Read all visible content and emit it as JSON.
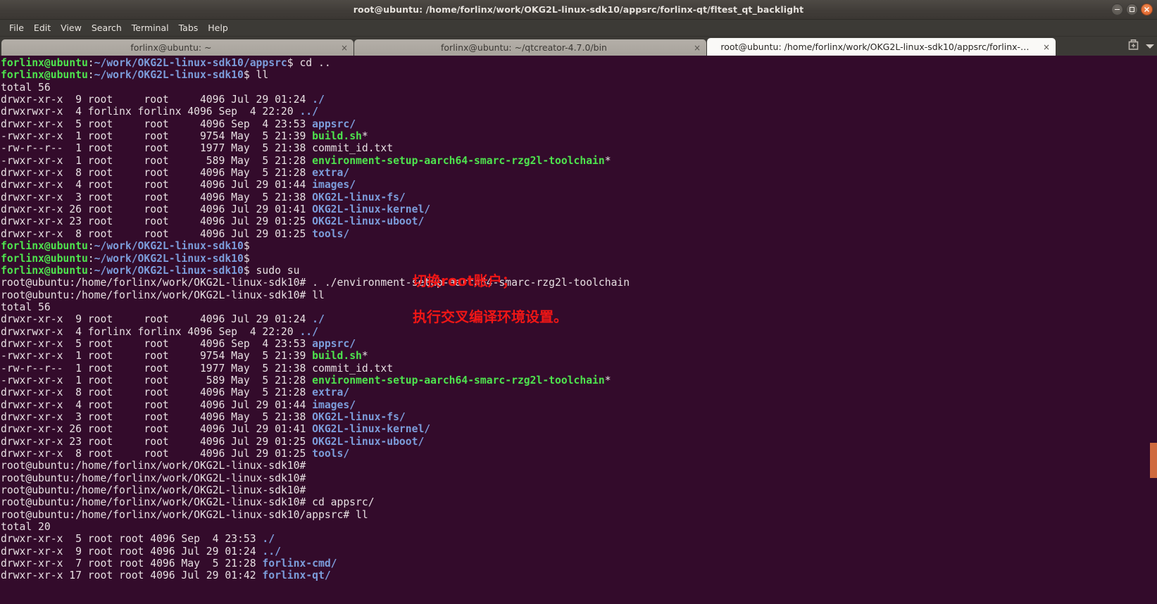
{
  "window": {
    "title": "root@ubuntu: /home/forlinx/work/OKG2L-linux-sdk10/appsrc/forlinx-qt/fltest_qt_backlight",
    "controls": {
      "minimize": "minimize",
      "maximize": "maximize",
      "close": "close"
    }
  },
  "menubar": {
    "items": [
      {
        "label": "File"
      },
      {
        "label": "Edit"
      },
      {
        "label": "View"
      },
      {
        "label": "Search"
      },
      {
        "label": "Terminal"
      },
      {
        "label": "Tabs"
      },
      {
        "label": "Help"
      }
    ]
  },
  "tabs": [
    {
      "label": "forlinx@ubuntu: ~",
      "close": "×",
      "active": false
    },
    {
      "label": "forlinx@ubuntu: ~/qtcreator-4.7.0/bin",
      "close": "×",
      "active": false
    },
    {
      "label": "root@ubuntu: /home/forlinx/work/OKG2L-linux-sdk10/appsrc/forlinx-…",
      "close": "×",
      "active": true
    }
  ],
  "tabbar_right": {
    "new_tab": "new-tab",
    "tab_list": "tab-list-dropdown"
  },
  "terminal": {
    "colors": {
      "background": "#330b2b",
      "foreground": "#e8e0e3",
      "green": "#4ee44e",
      "blue": "#7c9ddb",
      "annotation_red": "#f01616",
      "scrollbar": "#cf6a3f"
    },
    "lines": [
      [
        {
          "t": "forlinx@ubuntu",
          "c": "g"
        },
        {
          "t": ":",
          "c": "w"
        },
        {
          "t": "~/work/OKG2L-linux-sdk10/appsrc",
          "c": "b"
        },
        {
          "t": "$ cd ..",
          "c": "w"
        }
      ],
      [
        {
          "t": "forlinx@ubuntu",
          "c": "g"
        },
        {
          "t": ":",
          "c": "w"
        },
        {
          "t": "~/work/OKG2L-linux-sdk10",
          "c": "b"
        },
        {
          "t": "$ ll",
          "c": "w"
        }
      ],
      [
        {
          "t": "total 56",
          "c": "w"
        }
      ],
      [
        {
          "t": "drwxr-xr-x  9 root     root     4096 Jul 29 01:24 ",
          "c": "w"
        },
        {
          "t": "./",
          "c": "b"
        }
      ],
      [
        {
          "t": "drwxrwxr-x  4 forlinx forlinx 4096 Sep  4 22:20 ",
          "c": "w"
        },
        {
          "t": "../",
          "c": "b"
        }
      ],
      [
        {
          "t": "drwxr-xr-x  5 root     root     4096 Sep  4 23:53 ",
          "c": "w"
        },
        {
          "t": "appsrc/",
          "c": "b"
        }
      ],
      [
        {
          "t": "-rwxr-xr-x  1 root     root     9754 May  5 21:39 ",
          "c": "w"
        },
        {
          "t": "build.sh",
          "c": "gx"
        },
        {
          "t": "*",
          "c": "w"
        }
      ],
      [
        {
          "t": "-rw-r--r--  1 root     root     1977 May  5 21:38 commit_id.txt",
          "c": "w"
        }
      ],
      [
        {
          "t": "-rwxr-xr-x  1 root     root      589 May  5 21:28 ",
          "c": "w"
        },
        {
          "t": "environment-setup-aarch64-smarc-rzg2l-toolchain",
          "c": "gx"
        },
        {
          "t": "*",
          "c": "w"
        }
      ],
      [
        {
          "t": "drwxr-xr-x  8 root     root     4096 May  5 21:28 ",
          "c": "w"
        },
        {
          "t": "extra/",
          "c": "b"
        }
      ],
      [
        {
          "t": "drwxr-xr-x  4 root     root     4096 Jul 29 01:44 ",
          "c": "w"
        },
        {
          "t": "images/",
          "c": "b"
        }
      ],
      [
        {
          "t": "drwxr-xr-x  3 root     root     4096 May  5 21:38 ",
          "c": "w"
        },
        {
          "t": "OKG2L-linux-fs/",
          "c": "b"
        }
      ],
      [
        {
          "t": "drwxr-xr-x 26 root     root     4096 Jul 29 01:41 ",
          "c": "w"
        },
        {
          "t": "OKG2L-linux-kernel/",
          "c": "b"
        }
      ],
      [
        {
          "t": "drwxr-xr-x 23 root     root     4096 Jul 29 01:25 ",
          "c": "w"
        },
        {
          "t": "OKG2L-linux-uboot/",
          "c": "b"
        }
      ],
      [
        {
          "t": "drwxr-xr-x  8 root     root     4096 Jul 29 01:25 ",
          "c": "w"
        },
        {
          "t": "tools/",
          "c": "b"
        }
      ],
      [
        {
          "t": "forlinx@ubuntu",
          "c": "g"
        },
        {
          "t": ":",
          "c": "w"
        },
        {
          "t": "~/work/OKG2L-linux-sdk10",
          "c": "b"
        },
        {
          "t": "$ ",
          "c": "w"
        }
      ],
      [
        {
          "t": "forlinx@ubuntu",
          "c": "g"
        },
        {
          "t": ":",
          "c": "w"
        },
        {
          "t": "~/work/OKG2L-linux-sdk10",
          "c": "b"
        },
        {
          "t": "$ ",
          "c": "w"
        }
      ],
      [
        {
          "t": "forlinx@ubuntu",
          "c": "g"
        },
        {
          "t": ":",
          "c": "w"
        },
        {
          "t": "~/work/OKG2L-linux-sdk10",
          "c": "b"
        },
        {
          "t": "$ sudo su",
          "c": "w"
        }
      ],
      [
        {
          "t": "root@ubuntu:/home/forlinx/work/OKG2L-linux-sdk10# . ./environment-setup-aarch64-smarc-rzg2l-toolchain",
          "c": "w"
        }
      ],
      [
        {
          "t": "root@ubuntu:/home/forlinx/work/OKG2L-linux-sdk10# ll",
          "c": "w"
        }
      ],
      [
        {
          "t": "total 56",
          "c": "w"
        }
      ],
      [
        {
          "t": "drwxr-xr-x  9 root     root     4096 Jul 29 01:24 ",
          "c": "w"
        },
        {
          "t": "./",
          "c": "b"
        }
      ],
      [
        {
          "t": "drwxrwxr-x  4 forlinx forlinx 4096 Sep  4 22:20 ",
          "c": "w"
        },
        {
          "t": "../",
          "c": "b"
        }
      ],
      [
        {
          "t": "drwxr-xr-x  5 root     root     4096 Sep  4 23:53 ",
          "c": "w"
        },
        {
          "t": "appsrc/",
          "c": "b"
        }
      ],
      [
        {
          "t": "-rwxr-xr-x  1 root     root     9754 May  5 21:39 ",
          "c": "w"
        },
        {
          "t": "build.sh",
          "c": "gx"
        },
        {
          "t": "*",
          "c": "w"
        }
      ],
      [
        {
          "t": "-rw-r--r--  1 root     root     1977 May  5 21:38 commit_id.txt",
          "c": "w"
        }
      ],
      [
        {
          "t": "-rwxr-xr-x  1 root     root      589 May  5 21:28 ",
          "c": "w"
        },
        {
          "t": "environment-setup-aarch64-smarc-rzg2l-toolchain",
          "c": "gx"
        },
        {
          "t": "*",
          "c": "w"
        }
      ],
      [
        {
          "t": "drwxr-xr-x  8 root     root     4096 May  5 21:28 ",
          "c": "w"
        },
        {
          "t": "extra/",
          "c": "b"
        }
      ],
      [
        {
          "t": "drwxr-xr-x  4 root     root     4096 Jul 29 01:44 ",
          "c": "w"
        },
        {
          "t": "images/",
          "c": "b"
        }
      ],
      [
        {
          "t": "drwxr-xr-x  3 root     root     4096 May  5 21:38 ",
          "c": "w"
        },
        {
          "t": "OKG2L-linux-fs/",
          "c": "b"
        }
      ],
      [
        {
          "t": "drwxr-xr-x 26 root     root     4096 Jul 29 01:41 ",
          "c": "w"
        },
        {
          "t": "OKG2L-linux-kernel/",
          "c": "b"
        }
      ],
      [
        {
          "t": "drwxr-xr-x 23 root     root     4096 Jul 29 01:25 ",
          "c": "w"
        },
        {
          "t": "OKG2L-linux-uboot/",
          "c": "b"
        }
      ],
      [
        {
          "t": "drwxr-xr-x  8 root     root     4096 Jul 29 01:25 ",
          "c": "w"
        },
        {
          "t": "tools/",
          "c": "b"
        }
      ],
      [
        {
          "t": "root@ubuntu:/home/forlinx/work/OKG2L-linux-sdk10# ",
          "c": "w"
        }
      ],
      [
        {
          "t": "root@ubuntu:/home/forlinx/work/OKG2L-linux-sdk10# ",
          "c": "w"
        }
      ],
      [
        {
          "t": "root@ubuntu:/home/forlinx/work/OKG2L-linux-sdk10# ",
          "c": "w"
        }
      ],
      [
        {
          "t": "root@ubuntu:/home/forlinx/work/OKG2L-linux-sdk10# cd appsrc/",
          "c": "w"
        }
      ],
      [
        {
          "t": "root@ubuntu:/home/forlinx/work/OKG2L-linux-sdk10/appsrc# ll",
          "c": "w"
        }
      ],
      [
        {
          "t": "total 20",
          "c": "w"
        }
      ],
      [
        {
          "t": "drwxr-xr-x  5 root root 4096 Sep  4 23:53 ",
          "c": "w"
        },
        {
          "t": "./",
          "c": "b"
        }
      ],
      [
        {
          "t": "drwxr-xr-x  9 root root 4096 Jul 29 01:24 ",
          "c": "w"
        },
        {
          "t": "../",
          "c": "b"
        }
      ],
      [
        {
          "t": "drwxr-xr-x  7 root root 4096 May  5 21:28 ",
          "c": "w"
        },
        {
          "t": "forlinx-cmd/",
          "c": "b"
        }
      ],
      [
        {
          "t": "drwxr-xr-x 17 root root 4096 Jul 29 01:42 ",
          "c": "w"
        },
        {
          "t": "forlinx-qt/",
          "c": "b"
        }
      ]
    ],
    "annotations": [
      {
        "text": "切换root账户；"
      },
      {
        "text": "执行交叉编译环境设置。"
      }
    ]
  }
}
